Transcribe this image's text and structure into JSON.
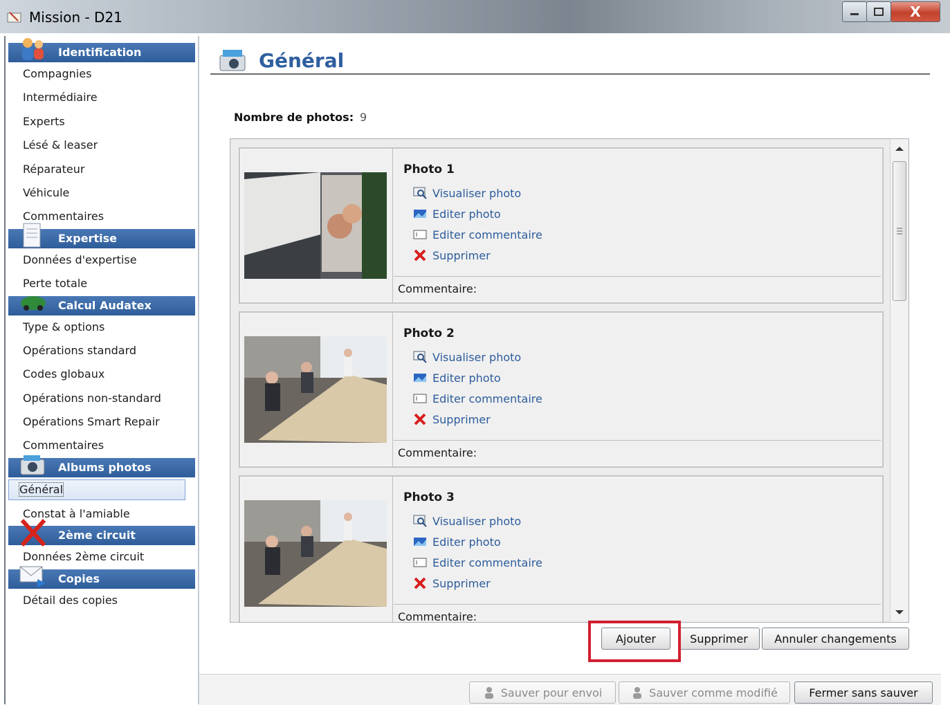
{
  "window": {
    "title": "Mission - D21",
    "controls": {
      "minimize_icon": "minimize-icon",
      "maximize_icon": "maximize-icon",
      "close_label": "X"
    }
  },
  "sidebar": {
    "sections": [
      {
        "label": "Identification",
        "icon": "people-icon",
        "items": [
          "Compagnies",
          "Intermédiaire",
          "Experts",
          "Lésé & leaser",
          "Réparateur",
          "Véhicule",
          "Commentaires"
        ]
      },
      {
        "label": "Expertise",
        "icon": "document-icon",
        "items": [
          "Données d'expertise",
          "Perte totale"
        ]
      },
      {
        "label": "Calcul Audatex",
        "icon": "car-icon",
        "items": [
          "Type & options",
          "Opérations standard",
          "Codes globaux",
          "Opérations non-standard",
          "Opérations Smart Repair",
          "Commentaires"
        ]
      },
      {
        "label": "Albums photos",
        "icon": "camera-icon",
        "items": [
          "Général",
          "Constat à l'amiable"
        ]
      },
      {
        "label": "2ème circuit",
        "icon": "red-x-icon",
        "items": [
          "Données 2ème circuit"
        ]
      },
      {
        "label": "Copies",
        "icon": "envelope-icon",
        "items": [
          "Détail des copies"
        ]
      }
    ],
    "selected_item": "Général"
  },
  "main": {
    "title": "Général",
    "count_label": "Nombre de photos:",
    "count_value": "9",
    "photos": [
      {
        "title": "Photo 1",
        "comment_label": "Commentaire:"
      },
      {
        "title": "Photo 2",
        "comment_label": "Commentaire:"
      },
      {
        "title": "Photo 3",
        "comment_label": "Commentaire:"
      }
    ],
    "actions": {
      "view": "Visualiser photo",
      "edit_photo": "Editer photo",
      "edit_comment": "Editer commentaire",
      "delete": "Supprimer"
    },
    "buttons": {
      "add": "Ajouter",
      "delete": "Supprimer",
      "cancel": "Annuler changements"
    },
    "footer": {
      "save_send": "Sauver pour envoi",
      "save_modified": "Sauver comme modifié",
      "close": "Fermer sans sauver"
    }
  },
  "colors": {
    "accent": "#2f5f9f",
    "section_header": "#3a68a8",
    "highlight": "#d1202f"
  }
}
